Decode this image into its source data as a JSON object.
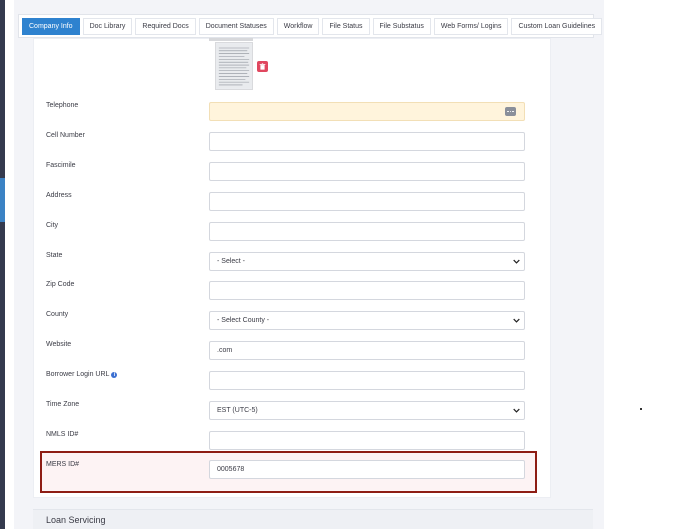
{
  "tabs": [
    {
      "label": "Company Info",
      "active": true
    },
    {
      "label": "Doc Library",
      "active": false
    },
    {
      "label": "Required Docs",
      "active": false
    },
    {
      "label": "Document Statuses",
      "active": false
    },
    {
      "label": "Workflow",
      "active": false
    },
    {
      "label": "File Status",
      "active": false
    },
    {
      "label": "File Substatus",
      "active": false
    },
    {
      "label": "Web Forms/ Logins",
      "active": false
    },
    {
      "label": "Custom Loan Guidelines",
      "active": false
    }
  ],
  "form": {
    "telephone": {
      "label": "Telephone",
      "value": ""
    },
    "cell_number": {
      "label": "Cell Number",
      "value": ""
    },
    "fascimile": {
      "label": "Fascimile",
      "value": ""
    },
    "address": {
      "label": "Address",
      "value": ""
    },
    "city": {
      "label": "City",
      "value": ""
    },
    "state": {
      "label": "State",
      "value": "- Select -"
    },
    "zip_code": {
      "label": "Zip Code",
      "value": ""
    },
    "county": {
      "label": "County",
      "value": "- Select County -"
    },
    "website": {
      "label": "Website",
      "value": ".com"
    },
    "borrower_login_url": {
      "label": "Borrower Login URL",
      "value": ""
    },
    "time_zone": {
      "label": "Time Zone",
      "value": "EST (UTC-5)"
    },
    "nmls_id": {
      "label": "NMLS ID#",
      "value": ""
    },
    "mers_id": {
      "label": "MERS ID#",
      "value": "0005678"
    }
  },
  "sections": {
    "loan_servicing": "Loan Servicing"
  },
  "colors": {
    "accent": "#2e82cf",
    "highlight_border": "#8e1d14",
    "phone_bg": "#fff4dc",
    "trash": "#e0475f"
  },
  "icons": {
    "logo": "document-thumbnail",
    "delete": "trash-icon",
    "phone_picker": "more-dots-icon",
    "info": "info-icon",
    "select": "chevron-down-icon"
  }
}
